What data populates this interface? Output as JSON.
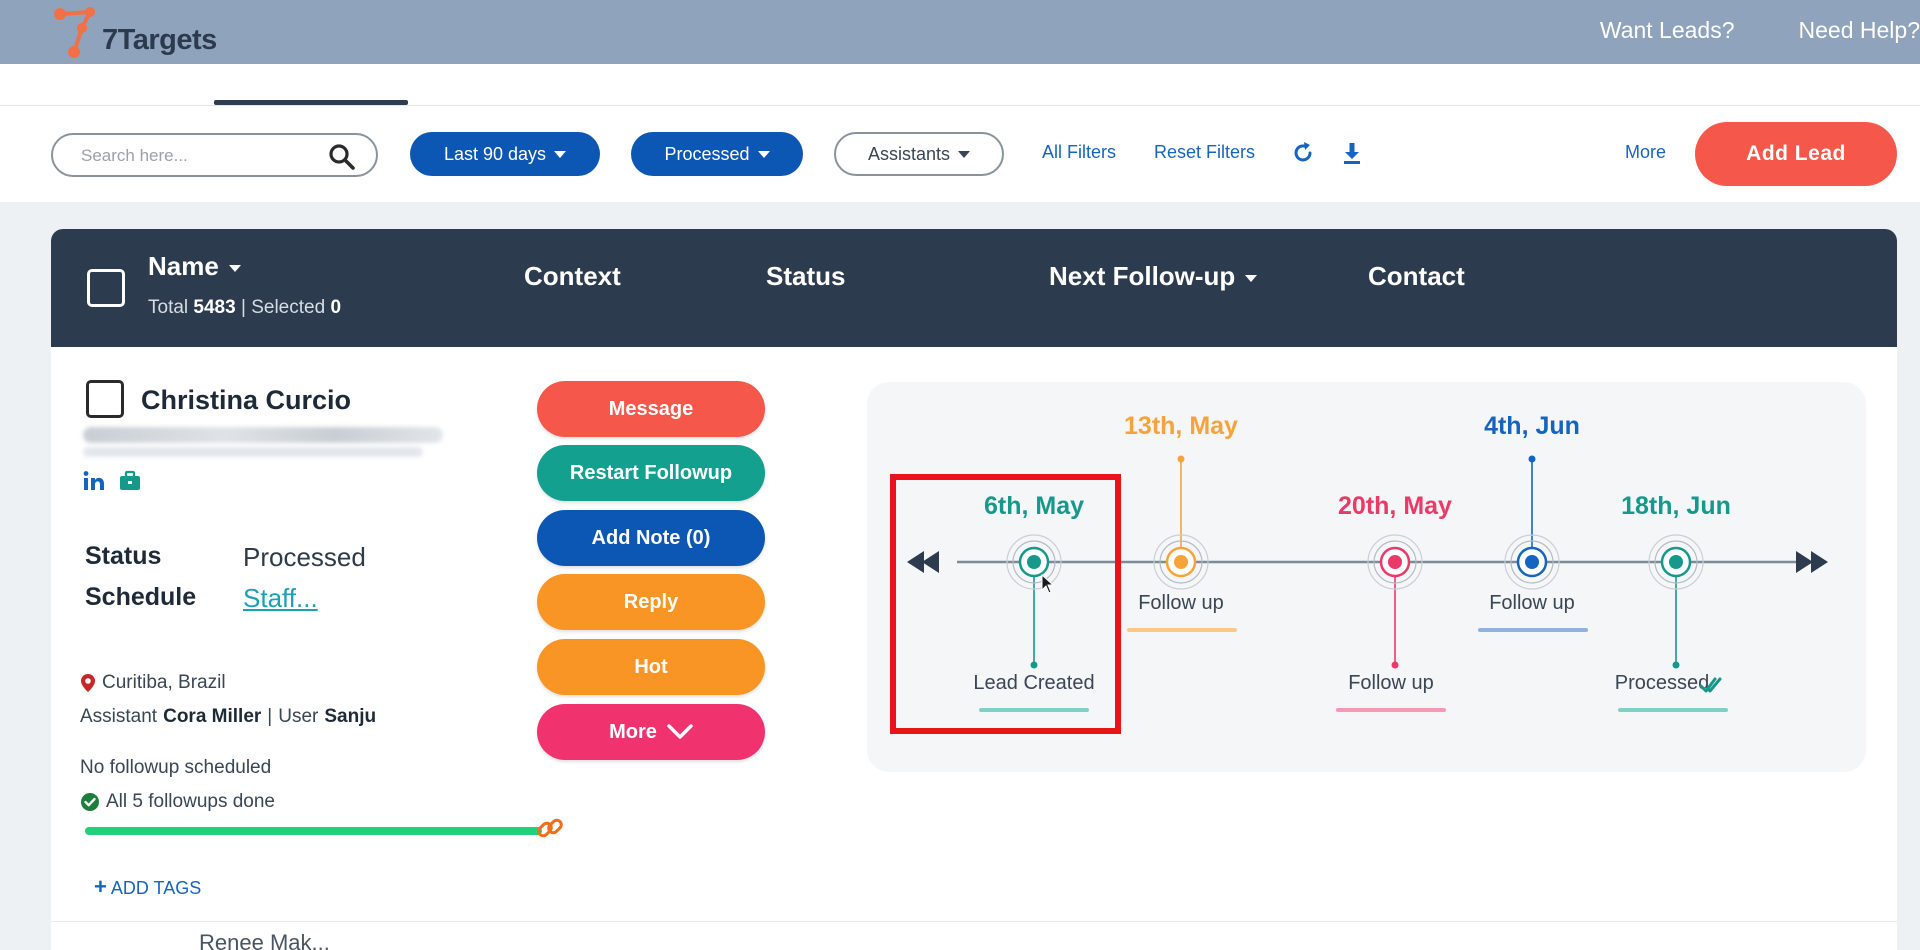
{
  "app": {
    "name": "7Targets",
    "brand_color": "#f36f45",
    "header_links": [
      "Want Leads?",
      "Need Help?"
    ]
  },
  "toolbar": {
    "search_placeholder": "Search here...",
    "date_filter": "Last 90 days",
    "status_filter": "Processed",
    "assistants_filter": "Assistants",
    "all_filters": "All Filters",
    "reset_filters": "Reset Filters",
    "more": "More",
    "add_lead": "Add Lead"
  },
  "table": {
    "columns": {
      "name": "Name",
      "context": "Context",
      "status": "Status",
      "next_followup": "Next Follow-up",
      "contact": "Contact"
    },
    "total_label": "Total",
    "total": "5483",
    "selected_label": "Selected",
    "selected": "0"
  },
  "lead": {
    "name": "Christina Curcio",
    "status_label": "Status",
    "status": "Processed",
    "schedule_label": "Schedule",
    "schedule": "Staff...",
    "location": "Curitiba, Brazil",
    "assistant_label": "Assistant",
    "assistant": "Cora Miller",
    "user_label": "User",
    "user": "Sanju",
    "followup_note": "No followup scheduled",
    "followups_done": "All 5 followups done",
    "followup_progress": 1.0,
    "add_tags": "ADD TAGS",
    "actions": {
      "message": "Message",
      "restart": "Restart Followup",
      "add_note": "Add Note (0)",
      "reply": "Reply",
      "hot": "Hot",
      "more": "More"
    }
  },
  "timeline": {
    "events": [
      {
        "date": "6th, May",
        "label": "Lead Created",
        "color": "#16998a"
      },
      {
        "date": "13th, May",
        "label": "Follow up",
        "color": "#f7a33c"
      },
      {
        "date": "20th, May",
        "label": "Follow up",
        "color": "#ea3a67"
      },
      {
        "date": "4th, Jun",
        "label": "Follow up",
        "color": "#1565c0"
      },
      {
        "date": "18th, Jun",
        "label": "Processed",
        "color": "#16998a"
      }
    ]
  },
  "next_row": {
    "name": "Renee Mak..."
  }
}
